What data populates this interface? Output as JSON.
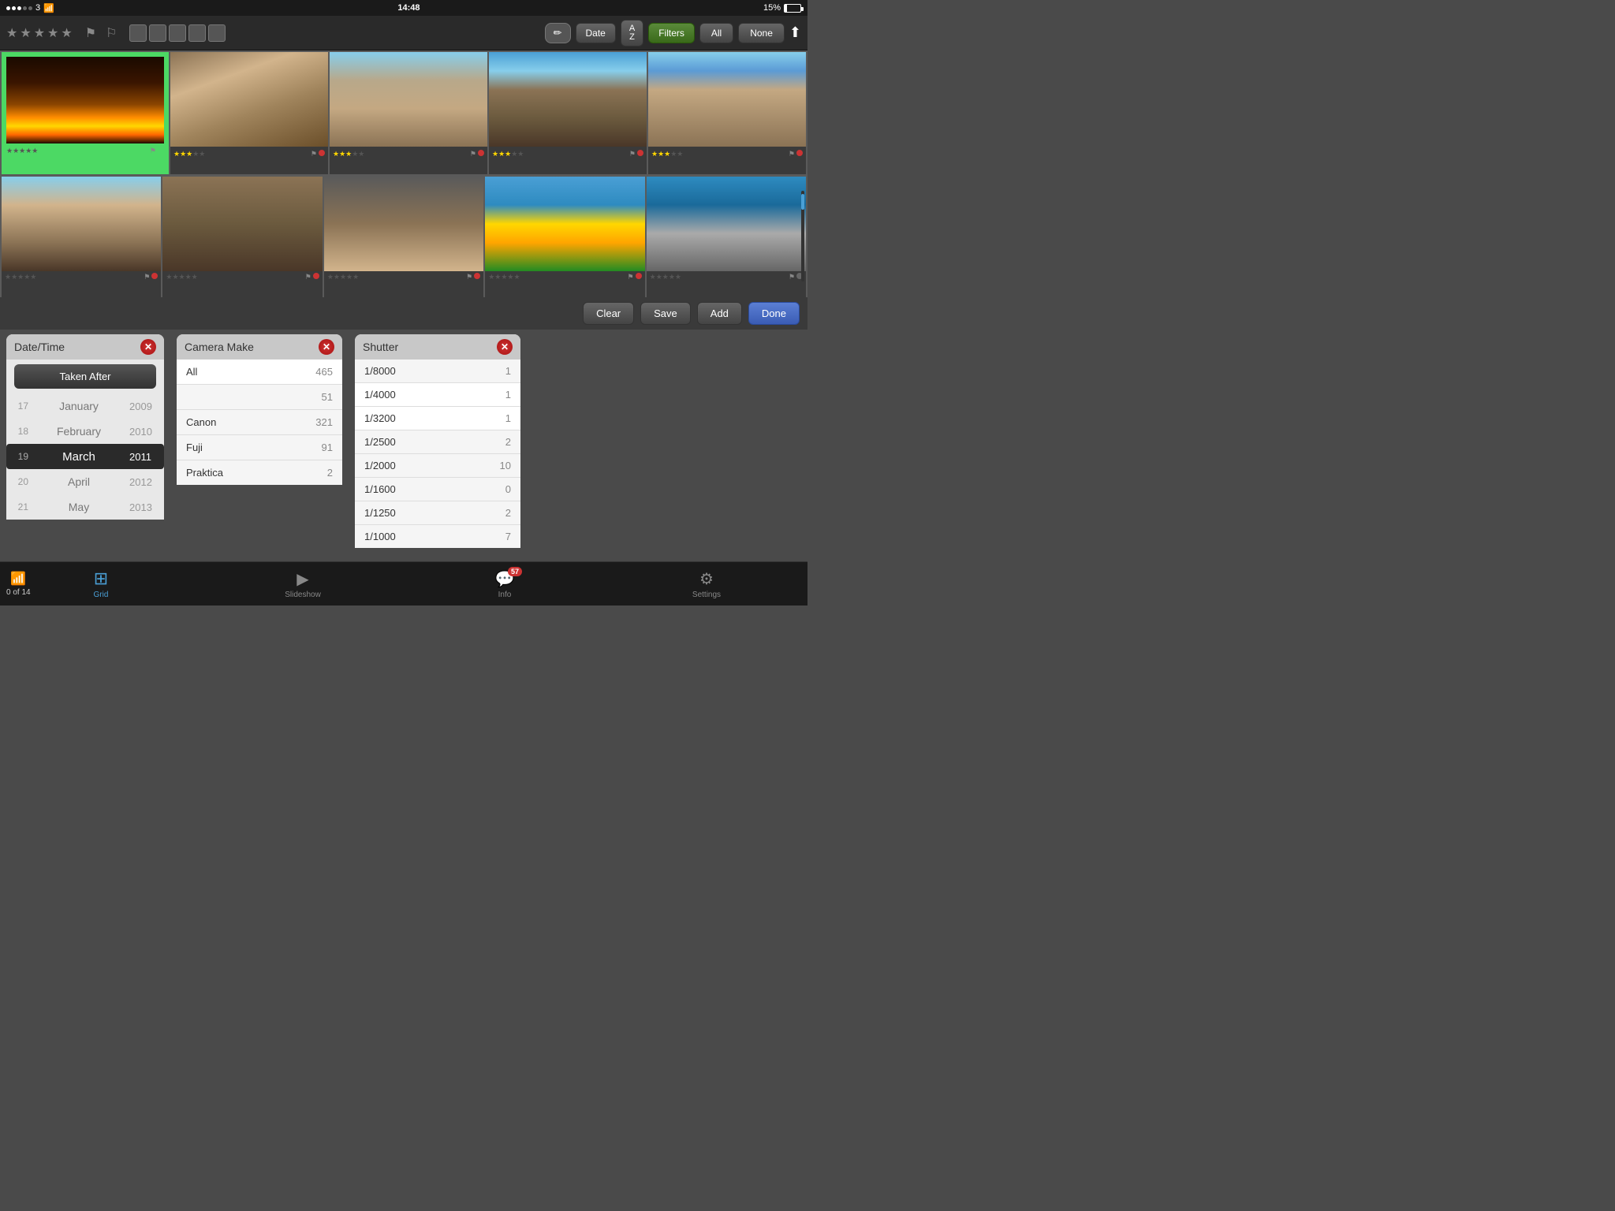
{
  "statusBar": {
    "carrier": "3",
    "signalDots": 5,
    "signalFilled": 3,
    "wifi": true,
    "time": "14:48",
    "battery": "15%"
  },
  "toolbar": {
    "eraser_label": "✏",
    "date_label": "Date",
    "az_top": "A",
    "az_bottom": "Z",
    "filters_label": "Filters",
    "all_label": "All",
    "none_label": "None",
    "share_label": "⬆"
  },
  "photoRows": {
    "row1": [
      {
        "id": 1,
        "selected": true,
        "stars": 0,
        "type": "sunset"
      },
      {
        "id": 2,
        "selected": false,
        "stars": 3,
        "type": "arch1"
      },
      {
        "id": 3,
        "selected": false,
        "stars": 3,
        "type": "arch2"
      },
      {
        "id": 4,
        "selected": false,
        "stars": 3,
        "type": "arch3"
      },
      {
        "id": 5,
        "selected": false,
        "stars": 3,
        "type": "arch4"
      }
    ],
    "row2": [
      {
        "id": 6,
        "selected": false,
        "stars": 0,
        "type": "arch5"
      },
      {
        "id": 7,
        "selected": false,
        "stars": 0,
        "type": "birds"
      },
      {
        "id": 8,
        "selected": false,
        "stars": 0,
        "type": "mosque"
      },
      {
        "id": 9,
        "selected": false,
        "stars": 0,
        "type": "mural"
      },
      {
        "id": 10,
        "selected": false,
        "stars": 0,
        "type": "building"
      }
    ]
  },
  "actions": {
    "clear_label": "Clear",
    "save_label": "Save",
    "add_label": "Add",
    "done_label": "Done"
  },
  "filterPanels": {
    "datetime": {
      "title": "Date/Time",
      "taken_after_label": "Taken After",
      "rows": [
        {
          "num": "17",
          "month": "January",
          "year": "2009"
        },
        {
          "num": "18",
          "month": "February",
          "year": "2010"
        },
        {
          "num": "19",
          "month": "March",
          "year": "2011",
          "selected": true
        },
        {
          "num": "20",
          "month": "April",
          "year": "2012"
        },
        {
          "num": "21",
          "month": "May",
          "year": "2013"
        }
      ]
    },
    "cameraMake": {
      "title": "Camera Make",
      "items": [
        {
          "label": "All",
          "count": "465"
        },
        {
          "label": "",
          "count": "51"
        },
        {
          "label": "Canon",
          "count": "321"
        },
        {
          "label": "Fuji",
          "count": "91"
        },
        {
          "label": "Praktica",
          "count": "2"
        }
      ]
    },
    "shutter": {
      "title": "Shutter",
      "items": [
        {
          "label": "1/8000",
          "count": "1"
        },
        {
          "label": "1/4000",
          "count": "1"
        },
        {
          "label": "1/3200",
          "count": "1"
        },
        {
          "label": "1/2500",
          "count": "2"
        },
        {
          "label": "1/2000",
          "count": "10"
        },
        {
          "label": "1/1600",
          "count": "0"
        },
        {
          "label": "1/1250",
          "count": "2"
        },
        {
          "label": "1/1000",
          "count": "7"
        }
      ]
    }
  },
  "bottomTabs": {
    "wifi_icon": "📶",
    "page_count": "0 of 14",
    "tabs": [
      {
        "id": "grid",
        "icon": "⊞",
        "label": "Grid",
        "active": true
      },
      {
        "id": "slideshow",
        "icon": "🎞",
        "label": "Slideshow",
        "active": false
      },
      {
        "id": "info",
        "icon": "💬",
        "label": "Info",
        "active": false,
        "badge": "57"
      },
      {
        "id": "settings",
        "icon": "⚙",
        "label": "Settings",
        "active": false
      }
    ]
  }
}
